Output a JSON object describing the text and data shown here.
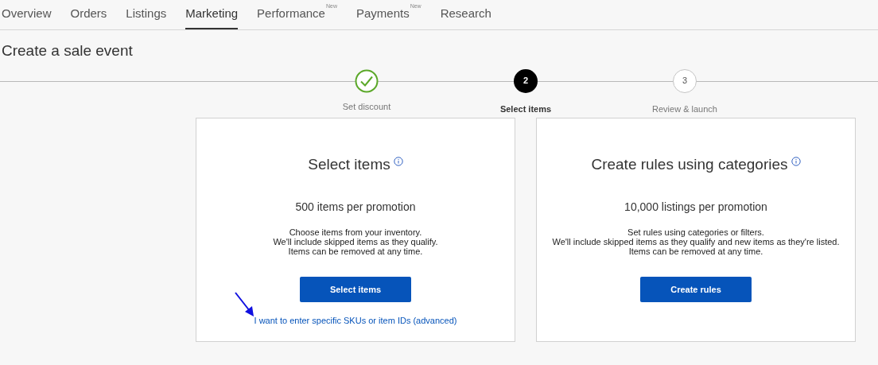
{
  "tabs": [
    {
      "label": "Overview",
      "selected": false
    },
    {
      "label": "Orders",
      "selected": false
    },
    {
      "label": "Listings",
      "selected": false
    },
    {
      "label": "Marketing",
      "selected": true
    },
    {
      "label": "Performance",
      "selected": false,
      "badge": "New"
    },
    {
      "label": "Payments",
      "selected": false,
      "badge": "New"
    },
    {
      "label": "Research",
      "selected": false
    }
  ],
  "page_title": "Create a sale event",
  "steps": [
    {
      "label": "Set discount",
      "kind": "done"
    },
    {
      "label": "Select items",
      "number": "2",
      "kind": "current"
    },
    {
      "label": "Review & launch",
      "number": "3",
      "kind": "upcoming"
    }
  ],
  "cards": [
    {
      "title": "Select items",
      "limit": "500 items per promotion",
      "description": [
        "Choose items from your inventory.",
        "We'll include skipped items as they qualify.",
        "Items can be removed at any time."
      ],
      "button": "Select items",
      "link": "I want to enter specific SKUs or item IDs (advanced)"
    },
    {
      "title": "Create rules using categories",
      "limit": "10,000 listings per promotion",
      "description": [
        "Set rules using categories or filters.",
        "We'll include skipped items as they qualify and new items as they're listed.",
        "Items can be removed at any time."
      ],
      "button": "Create rules"
    }
  ]
}
